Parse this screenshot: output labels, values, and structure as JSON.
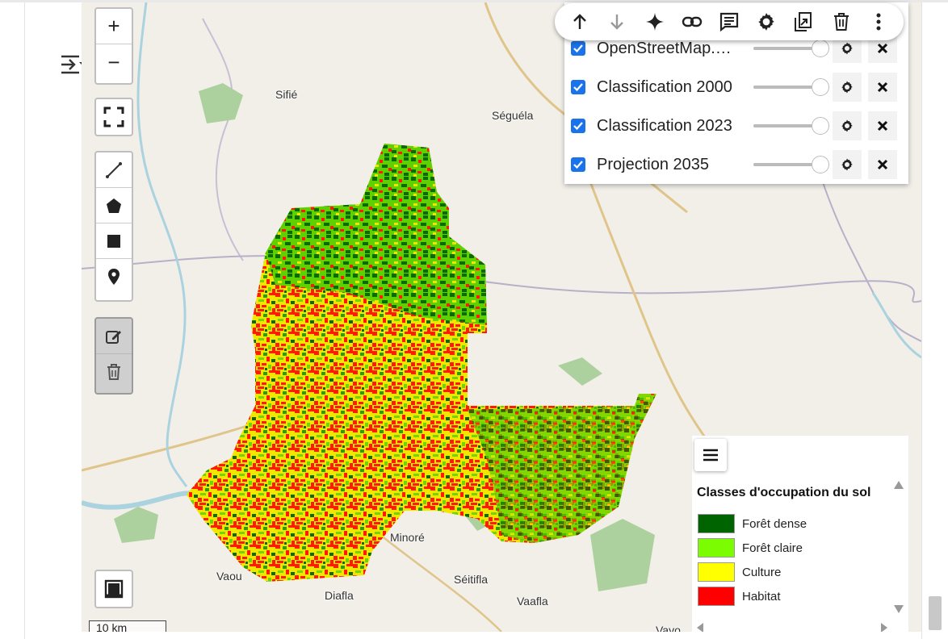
{
  "side": {
    "toggle_icon": "panel-toggle-icon"
  },
  "map": {
    "places": [
      {
        "name": "Sifié"
      },
      {
        "name": "Séguéla"
      },
      {
        "name": "Minoré"
      },
      {
        "name": "Vaou"
      },
      {
        "name": "Séitifla"
      },
      {
        "name": "Diafla"
      },
      {
        "name": "Vaafla"
      },
      {
        "name": "Vavo"
      }
    ],
    "scale_label": "10 km"
  },
  "controls": {
    "zoom_in": "+",
    "zoom_out": "−"
  },
  "layer_toolbar": {
    "icons": [
      "arrow-up-icon",
      "arrow-down-icon",
      "sparkle-icon",
      "link-icon",
      "comment-icon",
      "gear-icon",
      "export-icon",
      "trash-icon",
      "more-vert-icon"
    ]
  },
  "layers": [
    {
      "name": "OpenStreetMap.…",
      "checked": true,
      "opacity": 1.0
    },
    {
      "name": "Classification 2000",
      "checked": true,
      "opacity": 1.0
    },
    {
      "name": "Classification 2023",
      "checked": true,
      "opacity": 1.0
    },
    {
      "name": "Projection 2035",
      "checked": true,
      "opacity": 1.0
    }
  ],
  "legend": {
    "title": "Classes d'occupation du sol",
    "items": [
      {
        "label": "Forêt dense",
        "color": "#006400"
      },
      {
        "label": "Forêt claire",
        "color": "#7cfc00"
      },
      {
        "label": "Culture",
        "color": "#ffff00"
      },
      {
        "label": "Habitat",
        "color": "#ff0000"
      }
    ]
  }
}
